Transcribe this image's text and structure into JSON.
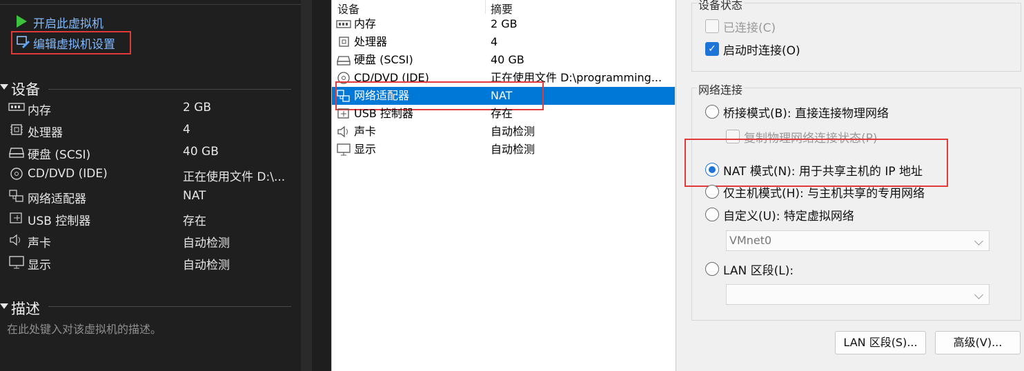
{
  "left": {
    "actions": {
      "start_vm": "开启此虚拟机",
      "edit_vm_settings": "编辑虚拟机设置"
    },
    "devices_title": "设备",
    "devices": [
      {
        "icon": "memory-icon",
        "label": "内存",
        "value": "2 GB"
      },
      {
        "icon": "processor-icon",
        "label": "处理器",
        "value": "4"
      },
      {
        "icon": "harddisk-icon",
        "label": "硬盘 (SCSI)",
        "value": "40 GB"
      },
      {
        "icon": "cdrom-icon",
        "label": "CD/DVD (IDE)",
        "value": "正在使用文件 D:\\..."
      },
      {
        "icon": "network-adapter-icon",
        "label": "网络适配器",
        "value": "NAT"
      },
      {
        "icon": "usb-icon",
        "label": "USB 控制器",
        "value": "存在"
      },
      {
        "icon": "sound-icon",
        "label": "声卡",
        "value": "自动检测"
      },
      {
        "icon": "display-icon",
        "label": "显示",
        "value": "自动检测"
      }
    ],
    "description_title": "描述",
    "description_placeholder": "在此处键入对该虚拟机的描述。"
  },
  "middle": {
    "headers": {
      "device": "设备",
      "summary": "摘要"
    },
    "rows": [
      {
        "icon": "memory-icon",
        "label": "内存",
        "value": "2 GB"
      },
      {
        "icon": "processor-icon",
        "label": "处理器",
        "value": "4"
      },
      {
        "icon": "harddisk-icon",
        "label": "硬盘 (SCSI)",
        "value": "40 GB"
      },
      {
        "icon": "cdrom-icon",
        "label": "CD/DVD (IDE)",
        "value": "正在使用文件 D:\\programming..."
      },
      {
        "icon": "network-adapter-icon",
        "label": "网络适配器",
        "value": "NAT"
      },
      {
        "icon": "usb-icon",
        "label": "USB 控制器",
        "value": "存在"
      },
      {
        "icon": "sound-icon",
        "label": "声卡",
        "value": "自动检测"
      },
      {
        "icon": "display-icon",
        "label": "显示",
        "value": "自动检测"
      }
    ],
    "selected_index": 4
  },
  "right": {
    "device_status": {
      "title": "设备状态",
      "connected": {
        "label": "已连接(C)",
        "checked": false
      },
      "connect_on_start": {
        "label": "启动时连接(O)",
        "checked": true
      }
    },
    "network": {
      "title": "网络连接",
      "bridged": "桥接模式(B): 直接连接物理网络",
      "replicate": "复制物理网络连接状态(P)",
      "nat": "NAT 模式(N): 用于共享主机的 IP 地址",
      "host_only": "仅主机模式(H): 与主机共享的专用网络",
      "custom": "自定义(U): 特定虚拟网络",
      "custom_value": "VMnet0",
      "lan": "LAN 区段(L):",
      "lan_value": "",
      "selected": "nat"
    },
    "buttons": {
      "lan_segments": "LAN 区段(S)...",
      "advanced": "高级(V)..."
    }
  },
  "colors": {
    "highlight_box": "#e03a3a",
    "selection": "#0078d7",
    "link": "#7fb8ff"
  }
}
